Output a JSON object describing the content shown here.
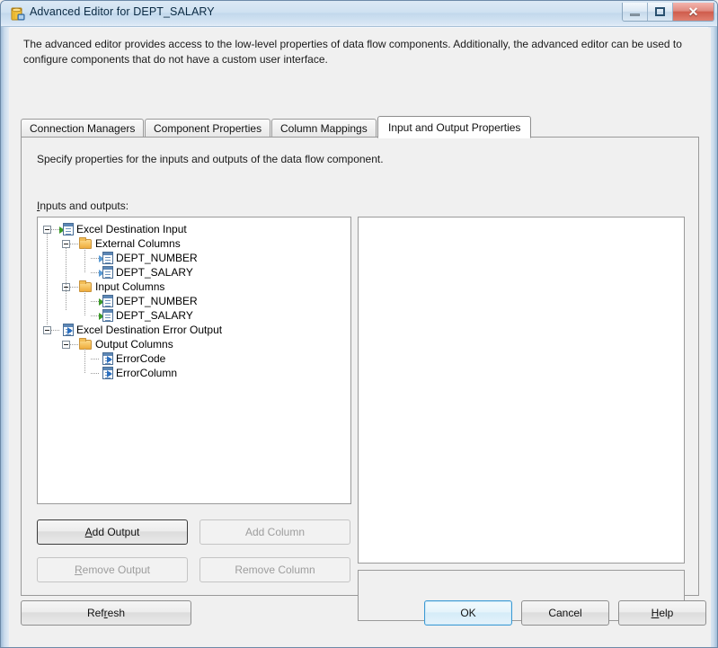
{
  "window": {
    "title": "Advanced Editor for DEPT_SALARY",
    "icon": "ssis-component-icon",
    "controls": {
      "minimize": "Minimize",
      "restore": "Restore",
      "close": "Close"
    }
  },
  "intro": {
    "text": "The advanced editor provides access to the low-level properties of data flow components. Additionally, the advanced editor can be used to configure components that do not have a custom user interface."
  },
  "tabs": [
    {
      "label": "Connection Managers",
      "selected": false
    },
    {
      "label": "Component Properties",
      "selected": false
    },
    {
      "label": "Column Mappings",
      "selected": false
    },
    {
      "label": "Input and Output Properties",
      "selected": true
    }
  ],
  "panel": {
    "description": "Specify properties for the inputs and outputs of the data flow component.",
    "section_label_prefix": "I",
    "section_label_rest": "nputs and outputs:"
  },
  "tree": [
    {
      "label": "Excel Destination Input",
      "depth": 0,
      "icon": "input-arrow-icon",
      "expander": true
    },
    {
      "label": "External Columns",
      "depth": 1,
      "icon": "folder-icon",
      "expander": true
    },
    {
      "label": "DEPT_NUMBER",
      "depth": 2,
      "icon": "external-column-icon",
      "expander": false
    },
    {
      "label": "DEPT_SALARY",
      "depth": 2,
      "icon": "external-column-icon",
      "expander": false
    },
    {
      "label": "Input Columns",
      "depth": 1,
      "icon": "folder-icon",
      "expander": true
    },
    {
      "label": "DEPT_NUMBER",
      "depth": 2,
      "icon": "input-column-icon",
      "expander": false
    },
    {
      "label": "DEPT_SALARY",
      "depth": 2,
      "icon": "input-column-icon",
      "expander": false
    },
    {
      "label": "Excel Destination Error Output",
      "depth": 0,
      "icon": "output-arrow-icon",
      "expander": true
    },
    {
      "label": "Output Columns",
      "depth": 1,
      "icon": "folder-icon",
      "expander": true
    },
    {
      "label": "ErrorCode",
      "depth": 2,
      "icon": "output-column-icon",
      "expander": false
    },
    {
      "label": "ErrorColumn",
      "depth": 2,
      "icon": "output-column-icon",
      "expander": false
    }
  ],
  "tree_buttons": {
    "add_output": {
      "prefix": "A",
      "rest": "dd Output",
      "enabled": true
    },
    "add_column": {
      "prefix": "Add C",
      "rest": "olumn",
      "enabled": false,
      "mnemonic": "C"
    },
    "remove_output": {
      "prefix": "R",
      "rest": "emove Output",
      "enabled": false
    },
    "remove_column": {
      "prefix": "Remove Col",
      "rest": "umn",
      "enabled": false,
      "mnemonic": "u"
    }
  },
  "footer_buttons": {
    "refresh": {
      "pre": "Ref",
      "mn": "r",
      "post": "esh"
    },
    "ok": {
      "label": "OK",
      "focused": true
    },
    "cancel": {
      "label": "Cancel"
    },
    "help": {
      "pre": "",
      "mn": "H",
      "post": "elp"
    }
  },
  "property_grid": {
    "rows": []
  },
  "property_description": {
    "title": "",
    "text": ""
  },
  "colors": {
    "accent_focus": "#3c9ad4",
    "titlebar": "#cfe1f1",
    "close_button": "#cf5c4c",
    "dialog_bg": "#f0f0f0",
    "folder_icon": "#f5c15c",
    "input_arrow": "#3c9a28",
    "output_arrow": "#2b6fc0"
  }
}
